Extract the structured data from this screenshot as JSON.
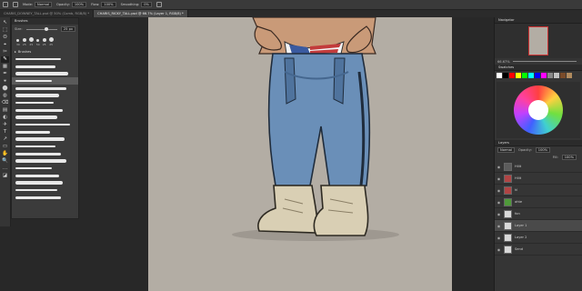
{
  "options_bar": {
    "items": [
      {
        "label": "Mode:",
        "value": "Normal"
      },
      {
        "label": "Opacity:",
        "value": "100%"
      },
      {
        "label": "Flow:",
        "value": "100%"
      },
      {
        "label": "Smoothing:",
        "value": "0%"
      }
    ]
  },
  "tabs": [
    {
      "label": "CHARIS_DOWNEY_TALL.psd @ 50% (Comb, RGB/8) *",
      "active": false
    },
    {
      "label": "CHARIS_RICKY_TALL.psd @ 66.7% (Layer 1, RGB/8) *",
      "active": true
    }
  ],
  "toolbar": {
    "tools": [
      "↖",
      "⬚",
      "ʘ",
      "⌖",
      "✂",
      "✎",
      "▦",
      "✒",
      "⚹",
      "⬤",
      "◍",
      "⌫",
      "▤",
      "◐",
      "✈",
      "T",
      "↗",
      "▭",
      "✋",
      "🔍",
      "…",
      "◪"
    ]
  },
  "brushes_panel": {
    "title": "Brushes",
    "size_label": "Size:",
    "size_value": "25 px",
    "group_label": "Brushes",
    "presets": [
      "30",
      "25",
      "25",
      "50",
      "25",
      "25"
    ]
  },
  "navigator_panel": {
    "title": "Navigator",
    "zoom": "66.67%"
  },
  "swatches_panel": {
    "title": "Swatches",
    "colors": [
      "#ffffff",
      "#000000",
      "#ff0000",
      "#ffff00",
      "#00ff00",
      "#00ffff",
      "#0000ff",
      "#ff00ff",
      "#888888",
      "#c0c0c0",
      "#7a4b2a",
      "#b08a5e"
    ]
  },
  "layers_panel": {
    "title": "Layers",
    "blend_mode": "Normal",
    "opacity_label": "Opacity:",
    "opacity_value": "100%",
    "fill_label": "Fill:",
    "fill_value": "100%",
    "layers": [
      {
        "name": "Hilit",
        "thumb": "#5c5c5c"
      },
      {
        "name": "Hilit",
        "thumb": "#b14444"
      },
      {
        "name": "hl",
        "thumb": "#b14444"
      },
      {
        "name": "ahte",
        "thumb": "#4f9a3a"
      },
      {
        "name": "fon",
        "thumb": "#d8d8d8"
      },
      {
        "name": "Layer 1",
        "thumb": "#d8d8d8",
        "selected": true
      },
      {
        "name": "Layer 2",
        "thumb": "#d8d8d8"
      },
      {
        "name": "Send",
        "thumb": "#d8d8d8"
      }
    ]
  },
  "colors": {
    "canvas_bg": "#b3ada4",
    "jeans": "#6a8fb8",
    "jeans_shadow": "#45678f",
    "boots": "#d9cfb4",
    "skin": "#c99a78"
  }
}
